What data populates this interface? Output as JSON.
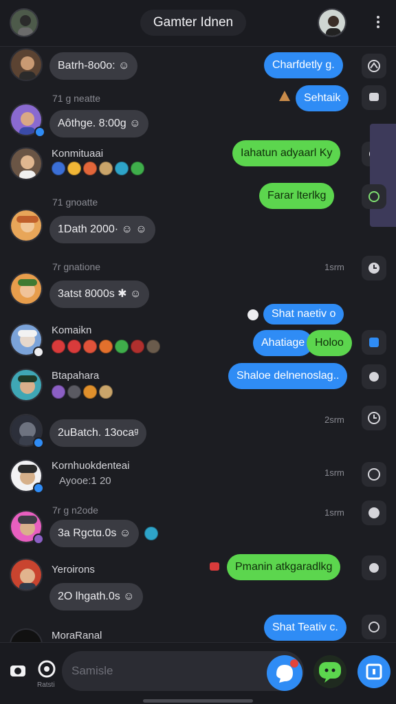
{
  "header": {
    "title": "Gamter Idnen",
    "more_icon": "more-vertical-icon"
  },
  "messages": [
    {
      "id": "m1",
      "text": "Batrh-8o0o: ☺"
    },
    {
      "id": "m2",
      "meta": "71 g neatte",
      "text": "Aôthge. 8:00g ☺"
    },
    {
      "id": "m3",
      "name": "Konmituaai"
    },
    {
      "id": "m4",
      "meta": "71 gnoatte",
      "text": "1Dath 2000· ☺ ☺"
    },
    {
      "id": "m5",
      "meta": "7r gnatione",
      "text": "3atst 8000s ✱ ☺"
    },
    {
      "id": "m6",
      "name": "Komaikn"
    },
    {
      "id": "m7",
      "name": "Btapahara"
    },
    {
      "id": "m8",
      "text": "2uBatch. 13ocaᵍ"
    },
    {
      "id": "m9",
      "name": "Kornhuokdenteai",
      "sub": "Ayooe:1 20"
    },
    {
      "id": "m10",
      "meta": "7r g n2ode",
      "text": "3a Rgctɑ.0s ☺"
    },
    {
      "id": "m11",
      "name": "Yeroirons",
      "text": "2O lhgath.0s ☺"
    },
    {
      "id": "m12",
      "name": "MoraRanal"
    }
  ],
  "outgoing": [
    {
      "id": "o1",
      "text": "Charfdetly g.",
      "color": "blue"
    },
    {
      "id": "o2",
      "text": "Sehtaik",
      "color": "blue"
    },
    {
      "id": "o3",
      "text": "Iahatun adyaarl Ky",
      "color": "green"
    },
    {
      "id": "o4",
      "text": "Farar lterlkg",
      "color": "green"
    },
    {
      "id": "o5",
      "text": "Shat naetiv o",
      "color": "blue"
    },
    {
      "id": "o6a",
      "text": "Ahatiage",
      "color": "blue"
    },
    {
      "id": "o6b",
      "text": "Holoo",
      "color": "green"
    },
    {
      "id": "o7",
      "text": "Shaloe delnenoslag..",
      "color": "blue"
    },
    {
      "id": "o8",
      "text": "Pmanin atkgaradlkg",
      "color": "green"
    },
    {
      "id": "o9",
      "text": "Shat Teativ c.",
      "color": "blue"
    }
  ],
  "times": {
    "t1": "1srm",
    "t2": "2srm",
    "t3": "1srm",
    "t4": "1srm"
  },
  "composer": {
    "placeholder": "Samisle",
    "left_label": "Ratsti"
  },
  "colors": {
    "accent_blue": "#2f8cf5",
    "accent_green": "#5cd64e",
    "background": "#1c1d22",
    "bubble_in": "#3a3b42"
  }
}
